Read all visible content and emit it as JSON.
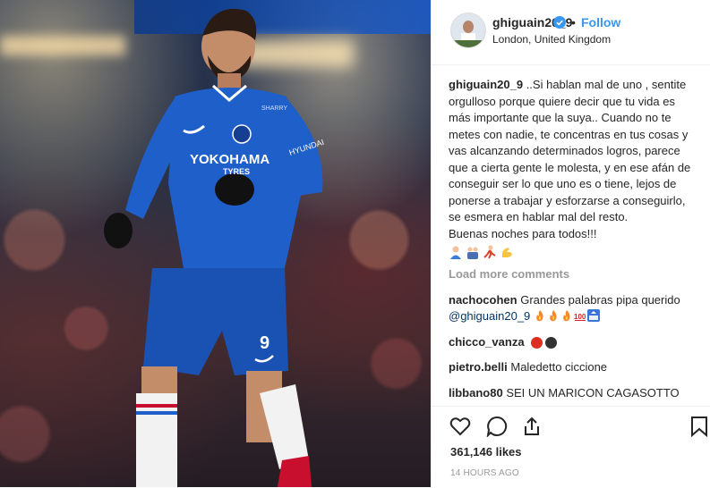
{
  "post": {
    "username": "ghiguain20_9",
    "follow_label": "Follow",
    "separator": "•",
    "location": "London, United Kingdom",
    "photo_text": {
      "sponsor": "YOKOHAMA",
      "sponsor_sub": "TYRES",
      "sleeve": "HYUNDAI",
      "maker": "SHARRY",
      "shorts_number": "9"
    }
  },
  "caption": {
    "username": "ghiguain20_9",
    "text": " ..Si hablan mal de uno , sentite orgulloso porque quiere decir que tu vida es más importante que la suya.. Cuando no te metes con nadie, te concentras en tus cosas y vas alcanzando determinados logros, parece que a cierta gente le molesta, y en ese afán de conseguir ser lo que uno es o tiene, lejos de ponerse a trabajar y esforzarse a conseguirlo, se esmera en hablar mal del resto.\nBuenas noches para todos!!!",
    "emojis": [
      "person-emoji",
      "family-emoji",
      "runner-emoji",
      "flexed-biceps-emoji"
    ]
  },
  "load_more": "Load more comments",
  "comments": [
    {
      "user": "nachocohen",
      "text": "Grandes palabras pipa querido ",
      "mention": "@ghiguain20_9",
      "emojis": [
        "fire-emoji",
        "fire-emoji",
        "fire-emoji",
        "hundred-emoji",
        "top-emoji"
      ]
    },
    {
      "user": "chicco_vanza",
      "text": "",
      "emojis": [
        "red-circle-emoji",
        "black-circle-emoji"
      ]
    },
    {
      "user": "pietro.belli",
      "text": "Maledetto ciccione"
    },
    {
      "user": "libbano80",
      "text": "SEI UN MARICON CAGASOTTO"
    }
  ],
  "likes": "361,146 likes",
  "timestamp": "14 HOURS AGO",
  "colors": {
    "accent": "#3897f0",
    "chelsea_blue": "#1f5fc9",
    "muted": "#999999"
  }
}
